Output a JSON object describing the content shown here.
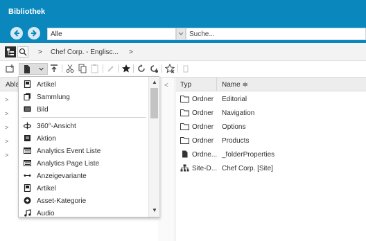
{
  "app": {
    "title": "Bibliothek"
  },
  "nav": {
    "scope_value": "Alle",
    "search_placeholder": "Suche..."
  },
  "breadcrumb": {
    "sep1": ">",
    "item": "Chef Corp. - Englisc...",
    "sep2": ">"
  },
  "left_pane": {
    "header": "Abla",
    "tree_chevron": ">"
  },
  "divider": {
    "collapse": "<"
  },
  "table": {
    "col_type": "Typ",
    "col_name": "Name",
    "sort_indicator": "≑",
    "rows": [
      {
        "type": "Ordner",
        "name": "Editorial",
        "icon": "folder-icon"
      },
      {
        "type": "Ordner",
        "name": "Navigation",
        "icon": "folder-icon"
      },
      {
        "type": "Ordner",
        "name": "Options",
        "icon": "folder-icon"
      },
      {
        "type": "Ordner",
        "name": "Products",
        "icon": "folder-icon"
      },
      {
        "type": "Ordne...",
        "name": "_folderProperties",
        "icon": "document-icon"
      },
      {
        "type": "Site-D...",
        "name": "Chef Corp. [Site]",
        "icon": "sitemap-icon"
      }
    ]
  },
  "new_menu": {
    "items": [
      {
        "label": "Artikel",
        "icon": "article-icon"
      },
      {
        "label": "Sammlung",
        "icon": "collection-icon"
      },
      {
        "label": "Bild",
        "icon": "image-icon"
      },
      {
        "label": "360°-Ansicht",
        "icon": "spinner-360-icon"
      },
      {
        "label": "Aktion",
        "icon": "action-icon"
      },
      {
        "label": "Analytics Event Liste",
        "icon": "analytics-list-icon"
      },
      {
        "label": "Analytics Page Liste",
        "icon": "analytics-list-icon"
      },
      {
        "label": "Anzeigevariante",
        "icon": "variant-icon"
      },
      {
        "label": "Artikel",
        "icon": "article-icon"
      },
      {
        "label": "Asset-Kategorie",
        "icon": "category-icon"
      },
      {
        "label": "Audio",
        "icon": "audio-icon"
      }
    ]
  },
  "colors": {
    "header_blue": "#0a88be",
    "nav_button": "#d6eaf3"
  }
}
